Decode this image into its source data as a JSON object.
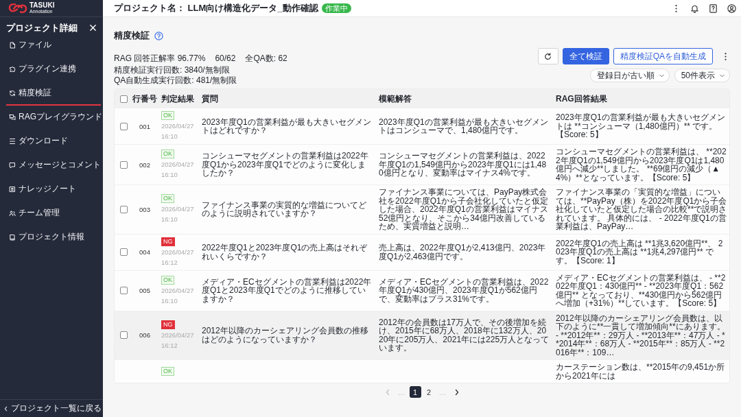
{
  "sidebar": {
    "logo": {
      "title": "TASUKI",
      "subtitle": "Annotation"
    },
    "heading": "プロジェクト詳細",
    "items": [
      {
        "label": "ファイル",
        "selected": false
      },
      {
        "label": "プラグイン連携",
        "selected": false
      },
      {
        "label": "精度検証",
        "selected": true
      },
      {
        "label": "RAGプレイグラウンド",
        "selected": false
      },
      {
        "label": "ダウンロード",
        "selected": false
      },
      {
        "label": "メッセージとコメント",
        "selected": false
      },
      {
        "label": "ナレッジノート",
        "selected": false
      },
      {
        "label": "チーム管理",
        "selected": false
      },
      {
        "label": "プロジェクト情報",
        "selected": false
      }
    ],
    "back_link": "プロジェクト一覧に戻る"
  },
  "header": {
    "title": "プロジェクト名： LLM向け構造化データ_動作確認",
    "status": "作業中"
  },
  "page": {
    "title": "精度検証"
  },
  "summary": {
    "accuracy": "RAG 回答正解率 96.77%",
    "ratio": "60/62",
    "total": "全QA数: 62",
    "runs": "精度検証実行回数: 3840/無制限",
    "auto_runs": "QA自動生成実行回数: 481/無制限"
  },
  "actions": {
    "verify_all": "全て検証",
    "auto_generate": "精度検証QAを自動生成"
  },
  "filters": {
    "sort": "登録日が古い順",
    "page_size": "50件表示"
  },
  "table": {
    "select_all": {
      "checked": false
    },
    "columns": [
      "行番号",
      "判定結果",
      "質問",
      "模範解答",
      "RAG回答結果"
    ],
    "rows": [
      {
        "checked": false,
        "hovered": false,
        "number": "001",
        "verdict": {
          "label": "OK",
          "kind": "pass"
        },
        "date": "2026/04/27",
        "time": "16:10",
        "question": "2023年度Q1の営業利益が最も大きいセグメントはどれですか？",
        "model_answer": "2023年度Q1の営業利益が最も大きいセグメントはコンシューマで、1,480億円です。",
        "rag_answer": "2023年度Q1の営業利益が最も大きいセグメントは **コンシューマ（1,480億円）** です。【Score: 5】"
      },
      {
        "checked": false,
        "hovered": false,
        "number": "002",
        "verdict": {
          "label": "OK",
          "kind": "pass"
        },
        "date": "2026/04/27",
        "time": "16:10",
        "question": "コンシューマセグメントの営業利益は2022年度Q1から2023年度Q1でどのように変化しましたか？",
        "model_answer": "コンシューマセグメントの営業利益は、2022年度Q1の1,549億円から2023年度Q1には1,480億円となり、変動率はマイナス4%です。",
        "rag_answer": "コンシューマセグメントの営業利益は、 **2022年度Q1の1,549億円から2023年度Q1は1,480億円へ減少**しました。 **69億円の減少（▲4%）**となっています。【Score: 5】"
      },
      {
        "checked": false,
        "hovered": false,
        "number": "003",
        "verdict": {
          "label": "OK",
          "kind": "pass"
        },
        "date": "2026/04/27",
        "time": "16:10",
        "question": "ファイナンス事業の実質的な増益についてどのように説明されていますか？",
        "model_answer": "ファイナンス事業については、PayPay株式会社を2022年度Q1から子会社化していたと仮定した場合、2022年度Q1の営業利益はマイナス52億円となり、そこから34億円改善しているため、実質増益と説明…",
        "rag_answer": "ファイナンス事業の「実質的な増益」については、**PayPay（株）を2022年度Q1から子会社化していたと仮定した場合の比較**で説明されています。 具体的には、 - 2022年度Q1の営業利益は、PayPay…"
      },
      {
        "checked": false,
        "hovered": false,
        "number": "004",
        "verdict": {
          "label": "NG",
          "kind": "fail"
        },
        "date": "2026/04/27",
        "time": "16:12",
        "question": "2022年度Q1と2023年度Q1の売上高はそれぞれいくらですか？",
        "model_answer": "売上高は、2022年度Q1が2,413億円、2023年度Q1が2,463億円です。",
        "rag_answer": "2022年度Q1の売上高は **1兆3,620億円**、 2023年度Q1の売上高は **1兆4,297億円** です。【Score: 1】"
      },
      {
        "checked": false,
        "hovered": false,
        "number": "005",
        "verdict": {
          "label": "OK",
          "kind": "pass"
        },
        "date": "2026/04/27",
        "time": "16:10",
        "question": "メディア・ECセグメントの営業利益は2022年度Q1と2023年度Q1でどのように推移していますか？",
        "model_answer": "メディア・ECセグメントの営業利益は、2022年度Q1が430億円、2023年度Q1が562億円で、変動率はプラス31%です。",
        "rag_answer": "メディア・ECセグメントの営業利益は、 - **2022年度Q1：430億円** - **2023年度Q1：562億円** となっており、**430億円から562億円へ増加（+31%）**しています。【Score: 5】"
      },
      {
        "checked": false,
        "hovered": true,
        "number": "006",
        "verdict": {
          "label": "NG",
          "kind": "fail"
        },
        "date": "2026/04/27",
        "time": "16:12",
        "question": "2012年以降のカーシェアリング会員数の推移はどのようになっていますか？",
        "model_answer": "2012年の会員数は17万人で、その後増加を続け、2015年に68万人、2018年に132万人、2020年に205万人、2021年には225万人となっています。",
        "rag_answer": "2012年以降のカーシェアリング会員数は、以下のように**一貫して増加傾向**にあります。 - **2012年**：29万人 - **2013年**：47万人 - **2014年**：68万人 - **2015年**：85万人 - **2016年**：109…"
      },
      {
        "hovered": false,
        "verdict": {
          "label": "OK",
          "kind": "pass"
        },
        "rag_answer": "カーステーション数は、**2015年の9,451か所から2021年には"
      }
    ]
  },
  "pagination": {
    "previous": {
      "disabled": true
    },
    "items": [
      {
        "label": "…",
        "kind": "ellipsis",
        "selected": false
      },
      {
        "label": "1",
        "kind": "page",
        "selected": true
      },
      {
        "label": "2",
        "kind": "page",
        "selected": false
      },
      {
        "label": "…",
        "kind": "ellipsis",
        "selected": false
      }
    ],
    "next": {
      "disabled": false
    }
  }
}
